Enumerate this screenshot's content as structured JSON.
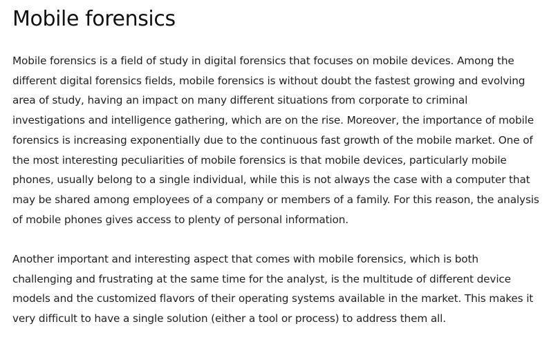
{
  "article": {
    "title": "Mobile forensics",
    "paragraphs": [
      "Mobile forensics is a field of study in digital forensics that focuses on mobile devices. Among the different digital forensics fields, mobile forensics is without doubt the fastest growing and evolving area of study, having an impact on many different situations from corporate to criminal investigations and intelligence gathering, which are on the rise. Moreover, the importance of mobile forensics is increasing exponentially due to the continuous fast growth of the mobile market. One of the most interesting peculiarities of mobile forensics is that mobile devices, particularly mobile phones, usually belong to a single individual, while this is not always the case with a computer that may be shared among employees of a company or members of a family. For this reason, the analysis of mobile phones gives access to plenty of personal information.",
      "Another important and interesting aspect that comes with mobile forensics, which is both challenging and frustrating at the same time for the analyst, is the multitude of different device models and the customized flavors of their operating systems available in the market. This makes it very difficult to have a single solution (either a tool or process) to address them all."
    ]
  }
}
